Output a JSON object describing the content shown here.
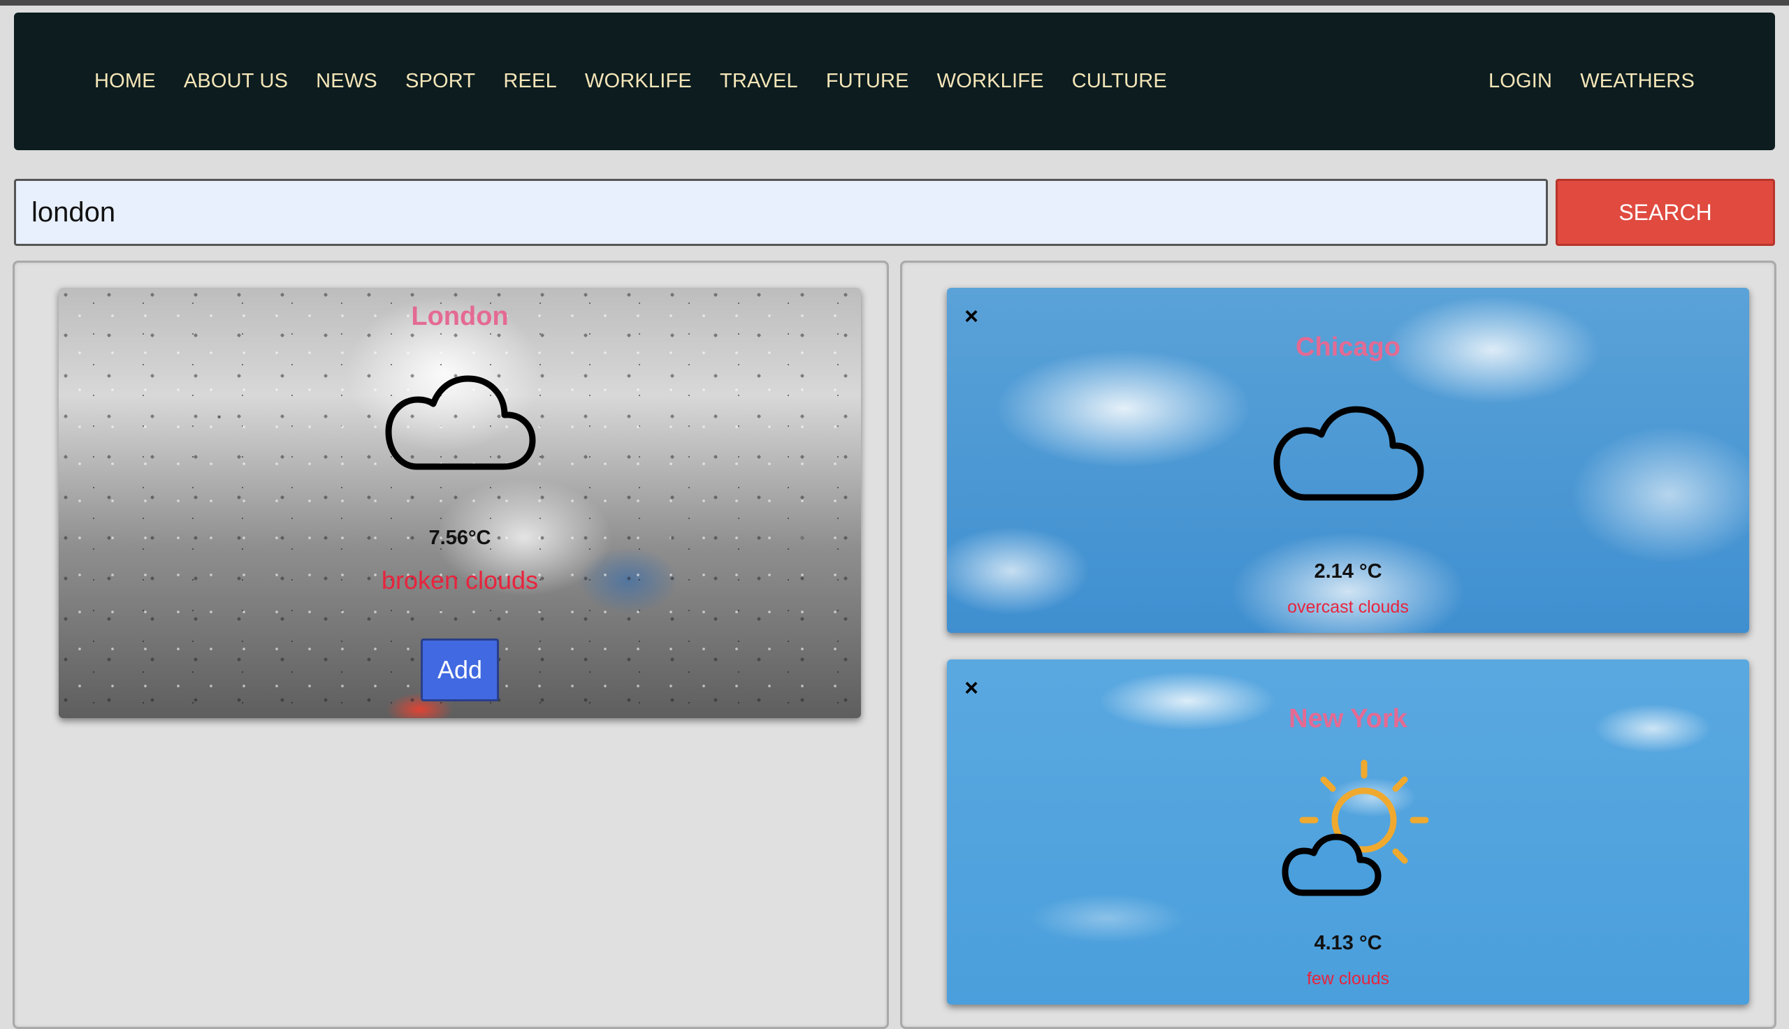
{
  "nav": {
    "left": [
      "HOME",
      "ABOUT US",
      "NEWS",
      "SPORT",
      "REEL",
      "WORKLIFE",
      "TRAVEL",
      "FUTURE",
      "WORKLIFE",
      "CULTURE"
    ],
    "right": [
      "LOGIN",
      "WEATHERS"
    ]
  },
  "search": {
    "value": "london",
    "button_label": "SEARCH"
  },
  "search_result": {
    "city": "London",
    "temp": "7.56°C",
    "description": "broken clouds",
    "icon": "cloud-icon",
    "add_label": "Add"
  },
  "favorites": [
    {
      "city": "Chicago",
      "temp": "2.14 °C",
      "description": "overcast clouds",
      "icon": "cloud-icon",
      "close_label": "×"
    },
    {
      "city": "New York",
      "temp": "4.13 °C",
      "description": "few clouds",
      "icon": "sun-behind-cloud-icon",
      "close_label": "×"
    }
  ],
  "colors": {
    "nav_bg": "#0c1c1f",
    "nav_text": "#f5e6b8",
    "search_button": "#e04a3f",
    "add_button": "#4169e1",
    "city_text": "#e46a93",
    "desc_text": "#e8243d"
  }
}
